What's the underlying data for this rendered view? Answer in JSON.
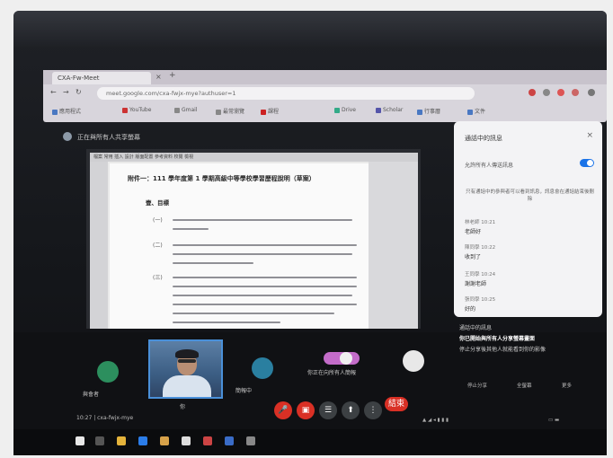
{
  "browser": {
    "tab_title": "CXA-Fw-Meet",
    "url": "meet.google.com/cxa-fwjx-mye?authuser=1",
    "bookmarks": [
      "應用程式",
      "YouTube",
      "Gmail",
      "最常瀏覽",
      "課程",
      "Drive",
      "Scholar",
      "行事曆",
      "文件"
    ]
  },
  "meet": {
    "presenting_label": "正在與所有人共享螢幕",
    "meeting_code": "10:27 | cxa-fwjx-mye",
    "self_label": "你",
    "tile_left_label": "與會者",
    "tile_right_label": "簡報中",
    "presenting_tile_label": "你正在向所有人簡報",
    "end_call": "結束"
  },
  "document": {
    "toolbar": "檔案 常用 插入 設計 版面配置 參考資料 校閱 檢視",
    "title": "附件一：111 學年度第 1 學期高級中等學校學習歷程說明（草案）",
    "subtitle": "壹、目標",
    "items": [
      "(一)",
      "(二)",
      "(三)"
    ]
  },
  "chat": {
    "title": "通話中的訊息",
    "setting": "允許所有人傳送訊息",
    "note": "只有通話中的參與者可以看到訊息，訊息會在通話結束後刪除",
    "messages": [
      {
        "name": "林老師  10:21",
        "text": "老師好"
      },
      {
        "name": "陳同學  10:22",
        "text": "收到了"
      },
      {
        "name": "王同學  10:24",
        "text": "謝謝老師"
      },
      {
        "name": "張同學  10:25",
        "text": "好的"
      }
    ]
  },
  "side": {
    "line1": "通話中的訊息",
    "line2": "你已開始與所有人分享螢幕畫面",
    "line3": "停止分享後其他人就能看到你的影像",
    "btns": [
      "停止分享",
      "全螢幕",
      "更多"
    ]
  },
  "colors": {
    "accent": "#1a73e8",
    "danger": "#d93025",
    "present_pill": "#c36cc9"
  }
}
